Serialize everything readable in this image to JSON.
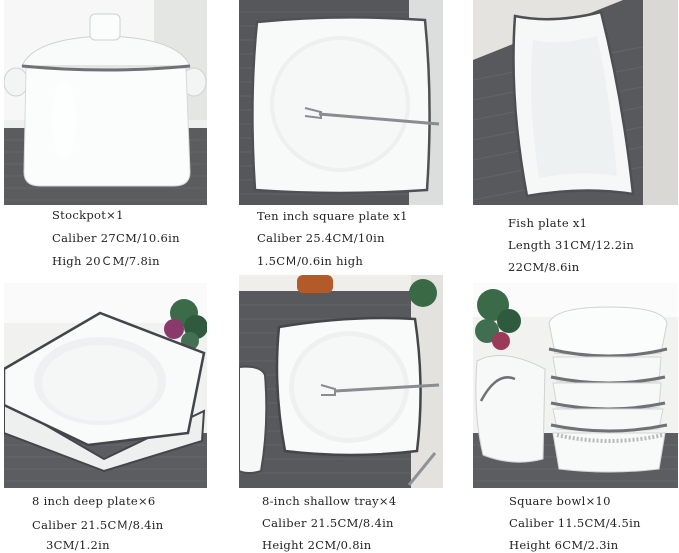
{
  "products": [
    {
      "id": "stockpot",
      "lines": [
        "Stockpot×1",
        "Caliber 27CM/10.6in",
        "High 20ＣM/7.8in"
      ]
    },
    {
      "id": "square-plate",
      "lines": [
        "Ten inch square plate x1",
        "Caliber 25.4CM/10in",
        "1.5CＭ/0.6in high"
      ]
    },
    {
      "id": "fish-plate",
      "lines": [
        "Fish plate x1",
        "Length 31CM/12.2in",
        "22CM/8.6in"
      ]
    },
    {
      "id": "deep-plate",
      "lines": [
        "8 inch deep plate×6",
        "Caliber 21.5CＭ/8.4in",
        "3CM/1.2in"
      ]
    },
    {
      "id": "shallow-tray",
      "lines": [
        "8-inch shallow tray×4",
        "Caliber 21.5CM/8.4in",
        "Height 2CM/0.8in"
      ]
    },
    {
      "id": "square-bowl",
      "lines": [
        "Square bowl×10",
        "Caliber 11.5CM/4.5in",
        "Height 6CM/2.3in"
      ]
    }
  ]
}
